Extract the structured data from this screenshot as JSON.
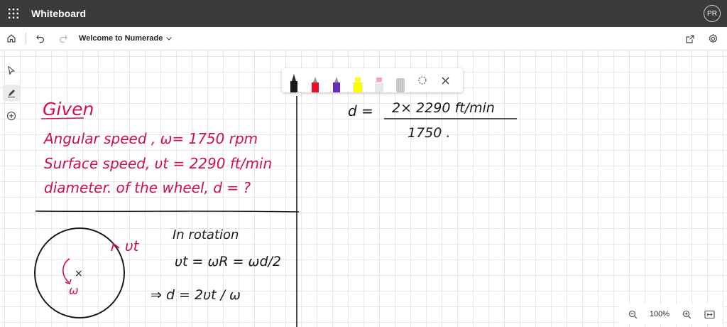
{
  "app": {
    "title": "Whiteboard",
    "user_initials": "PR"
  },
  "toolbar": {
    "board_name": "Welcome to Numerade"
  },
  "zoom": {
    "level": "100%"
  },
  "pen_tray": {
    "pens": [
      {
        "name": "black-pen",
        "color": "#1a1a1a"
      },
      {
        "name": "red-pen",
        "color": "#e8112d"
      },
      {
        "name": "purple-pen",
        "color": "#6a2bbf"
      },
      {
        "name": "yellow-highlighter",
        "color": "#ffff00"
      },
      {
        "name": "pink-highlighter",
        "color": "#f4a6c0"
      },
      {
        "name": "gray-eraser",
        "color": "#cfcfcf"
      }
    ]
  },
  "ink": {
    "red_color": "#d0104c",
    "black_color": "#1a1a1a",
    "given_heading": "Given",
    "given_line_1": "Angular  speed , ω= 1750 rpm",
    "given_line_2": "Surface  speed,  υt = 2290 ft/min",
    "given_line_3": "diameter. of the wheel, d = ?",
    "rotation_heading": "In rotation",
    "rotation_formula": "υt = ωR = ωd/2",
    "d_formula": "⇒ d = 2υt / ω",
    "circle_vt_label": "υt",
    "circle_omega_label": "ω",
    "circle_center_mark": "×",
    "calc_lhs": "d =",
    "calc_numerator": "2× 2290  ft/min",
    "calc_denominator": "1750 ."
  }
}
